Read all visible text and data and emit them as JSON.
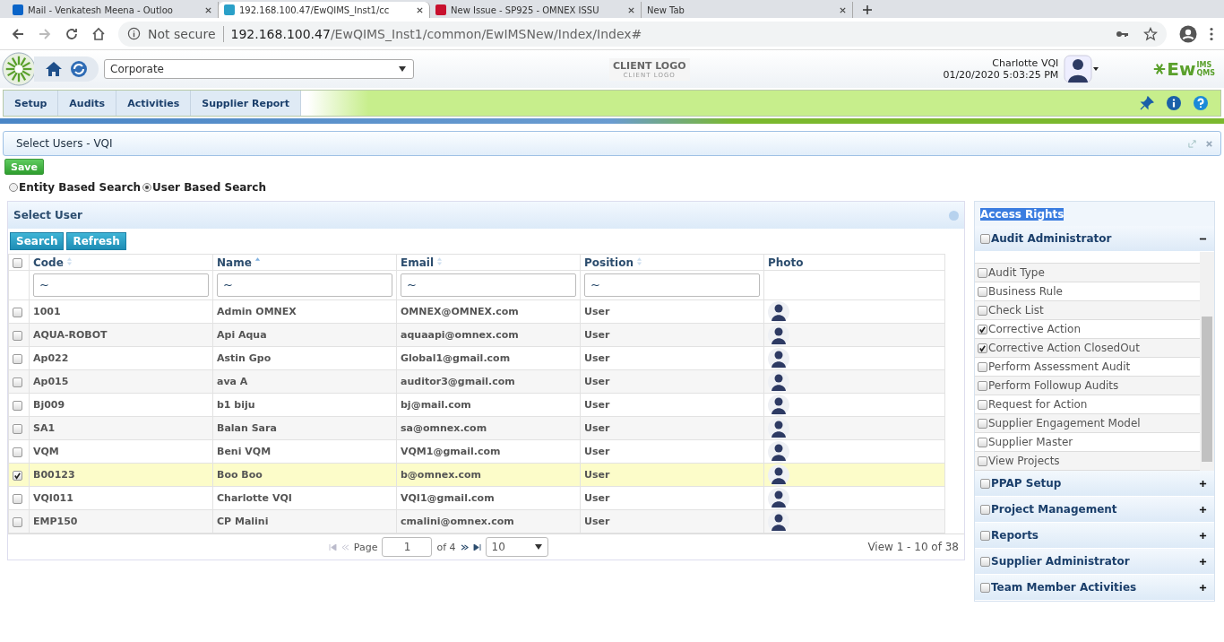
{
  "browser": {
    "tabs": [
      {
        "title": "Mail - Venkatesh Meena - Outloo",
        "selected": false,
        "kind": "mail"
      },
      {
        "title": "192.168.100.47/EwQIMS_Inst1/cc",
        "selected": true,
        "kind": "app"
      },
      {
        "title": "New Issue - SP925 - OMNEX ISSU",
        "selected": false,
        "kind": "issue"
      },
      {
        "title": "New Tab",
        "selected": false,
        "kind": "blank"
      }
    ],
    "security": "Not secure",
    "url_host": "192.168.100.47",
    "url_path": "/EwQIMS_Inst1/common/EwIMSNew/Index/Index#"
  },
  "header": {
    "entity": "Corporate",
    "client_logo": "CLIENT LOGO",
    "client_logo_sub": "CLIENT LOGO",
    "user": "Charlotte VQI",
    "datetime": "01/20/2020 5:03:25 PM",
    "brand_main": "Ew",
    "brand_top": "IMS",
    "brand_bottom": "QMS"
  },
  "menu": [
    "Setup",
    "Audits",
    "Activities",
    "Supplier Report"
  ],
  "page": {
    "title": "Select Users - VQI",
    "save": "Save",
    "search_modes": [
      {
        "label": "Entity Based Search",
        "selected": false
      },
      {
        "label": "User Based Search",
        "selected": true
      }
    ]
  },
  "grid": {
    "title": "Select User",
    "buttons": [
      "Search",
      "Refresh"
    ],
    "all_checked": false,
    "columns": [
      {
        "label": "Code",
        "sorted": false,
        "filter": "~"
      },
      {
        "label": "Name",
        "sorted": true,
        "filter": "~"
      },
      {
        "label": "Email",
        "sorted": false,
        "filter": "~"
      },
      {
        "label": "Position",
        "sorted": false,
        "filter": "~"
      },
      {
        "label": "Photo"
      }
    ],
    "rows": [
      {
        "code": "1001",
        "name": "Admin OMNEX",
        "email": "OMNEX@OMNEX.com",
        "position": "User",
        "checked": false
      },
      {
        "code": "AQUA-ROBOT",
        "name": "Api Aqua",
        "email": "aquaapi@omnex.com",
        "position": "User",
        "checked": false
      },
      {
        "code": "Ap022",
        "name": "Astin Gpo",
        "email": "Global1@gmail.com",
        "position": "User",
        "checked": false
      },
      {
        "code": "Ap015",
        "name": "ava A",
        "email": "auditor3@gmail.com",
        "position": "User",
        "checked": false
      },
      {
        "code": "Bj009",
        "name": "b1 biju",
        "email": "bj@mail.com",
        "position": "User",
        "checked": false
      },
      {
        "code": "SA1",
        "name": "Balan Sara",
        "email": "sa@omnex.com",
        "position": "User",
        "checked": false
      },
      {
        "code": "VQM",
        "name": "Beni VQM",
        "email": "VQM1@gmail.com",
        "position": "User",
        "checked": false
      },
      {
        "code": "B00123",
        "name": "Boo Boo",
        "email": "b@omnex.com",
        "position": "User",
        "checked": true
      },
      {
        "code": "VQI011",
        "name": "Charlotte VQI",
        "email": "VQI1@gmail.com",
        "position": "User",
        "checked": false
      },
      {
        "code": "EMP150",
        "name": "CP Malini",
        "email": "cmalini@omnex.com",
        "position": "User",
        "checked": false
      }
    ],
    "pager": {
      "page_label": "Page",
      "page": "1",
      "of": "of 4",
      "page_size": "10",
      "view": "View 1 - 10 of 38"
    }
  },
  "access": {
    "title": "Access Rights",
    "groups": [
      {
        "label": "Audit Administrator",
        "checked": false,
        "expanded": true,
        "children": [
          {
            "label": "Audit Type",
            "checked": false
          },
          {
            "label": "Business Rule",
            "checked": false
          },
          {
            "label": "Check List",
            "checked": false
          },
          {
            "label": "Corrective Action",
            "checked": true
          },
          {
            "label": "Corrective Action ClosedOut",
            "checked": true
          },
          {
            "label": "Perform Assessment Audit",
            "checked": false
          },
          {
            "label": "Perform Followup Audits",
            "checked": false
          },
          {
            "label": "Request for Action",
            "checked": false
          },
          {
            "label": "Supplier Engagement Model",
            "checked": false
          },
          {
            "label": "Supplier Master",
            "checked": false
          },
          {
            "label": "View Projects",
            "checked": false
          }
        ]
      },
      {
        "label": "PPAP Setup",
        "checked": false,
        "expanded": false
      },
      {
        "label": "Project Management",
        "checked": false,
        "expanded": false
      },
      {
        "label": "Reports",
        "checked": false,
        "expanded": false
      },
      {
        "label": "Supplier Administrator",
        "checked": false,
        "expanded": false
      },
      {
        "label": "Team Member Activities",
        "checked": false,
        "expanded": false
      }
    ]
  }
}
